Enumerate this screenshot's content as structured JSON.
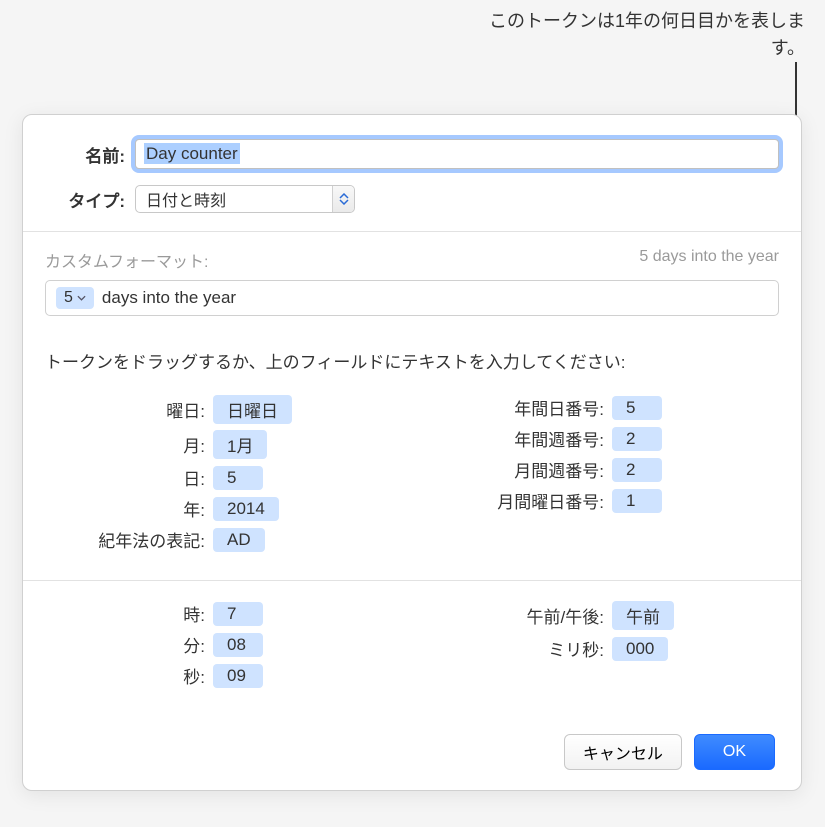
{
  "callout": "このトークンは1年の何日目かを表します。",
  "labels": {
    "name": "名前:",
    "type": "タイプ:",
    "custom_format": "カスタムフォーマット:",
    "instructions": "トークンをドラッグするか、上のフィールドにテキストを入力してください:"
  },
  "fields": {
    "name_value": "Day counter",
    "type_value": "日付と時刻",
    "format_preview": "5 days into the year",
    "format_token_value": "5",
    "format_text_after": "days into the year"
  },
  "tokens_left": [
    {
      "label": "曜日:",
      "value": "日曜日"
    },
    {
      "label": "月:",
      "value": "1月"
    },
    {
      "label": "日:",
      "value": "5"
    },
    {
      "label": "年:",
      "value": "2014"
    },
    {
      "label": "紀年法の表記:",
      "value": "AD"
    }
  ],
  "tokens_right": [
    {
      "label": "年間日番号:",
      "value": "5"
    },
    {
      "label": "年間週番号:",
      "value": "2"
    },
    {
      "label": "月間週番号:",
      "value": "2"
    },
    {
      "label": "月間曜日番号:",
      "value": "1"
    }
  ],
  "tokens_time_left": [
    {
      "label": "時:",
      "value": "7"
    },
    {
      "label": "分:",
      "value": "08"
    },
    {
      "label": "秒:",
      "value": "09"
    }
  ],
  "tokens_time_right": [
    {
      "label": "午前/午後:",
      "value": "午前"
    },
    {
      "label": "ミリ秒:",
      "value": "000"
    }
  ],
  "buttons": {
    "cancel": "キャンセル",
    "ok": "OK"
  }
}
